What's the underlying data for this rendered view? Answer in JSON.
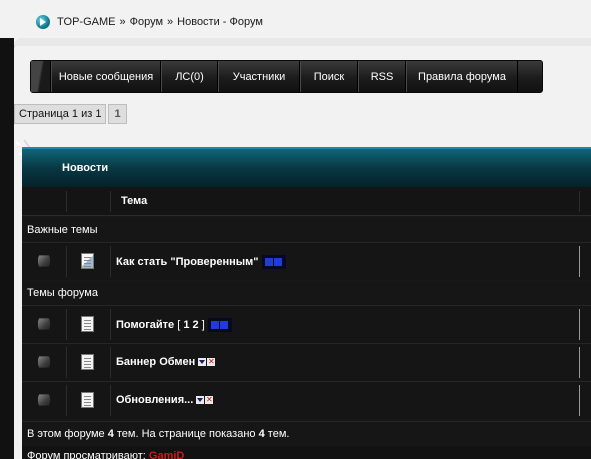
{
  "breadcrumb": {
    "site": "TOP-GAME",
    "sep1": "»",
    "forum": "Форум",
    "sep2": "»",
    "current": "Новости - Форум"
  },
  "navbar": {
    "items": [
      {
        "label": "Новые сообщения"
      },
      {
        "label": "ЛС(0)"
      },
      {
        "label": "Участники"
      },
      {
        "label": "Поиск"
      },
      {
        "label": "RSS"
      },
      {
        "label": "Правила форума"
      }
    ]
  },
  "pagination": {
    "info": "Страница 1 из 1",
    "page": "1"
  },
  "forum": {
    "title": "Новости",
    "column_topic": "Тема",
    "important_label": "Важные темы",
    "topics_label": "Темы форума",
    "topics": [
      {
        "title": "Как стать \"Проверенным\"",
        "sticky": true
      },
      {
        "title": "Помогайте",
        "pages_open": "[",
        "p1": "1",
        "p2": "2",
        "pages_close": "]"
      },
      {
        "title": "Баннер Обмен"
      },
      {
        "title": "Обновления..."
      }
    ],
    "footer_prefix": "В этом форуме",
    "footer_count": "4",
    "footer_mid": "тем. На странице показано",
    "footer_shown": "4",
    "footer_suffix": "тем.",
    "viewers_label": "Форум просматривают:",
    "viewer_user": "GamiD"
  },
  "colors": {
    "accent": "#0f6678",
    "user_highlight": "#d11a1a"
  }
}
